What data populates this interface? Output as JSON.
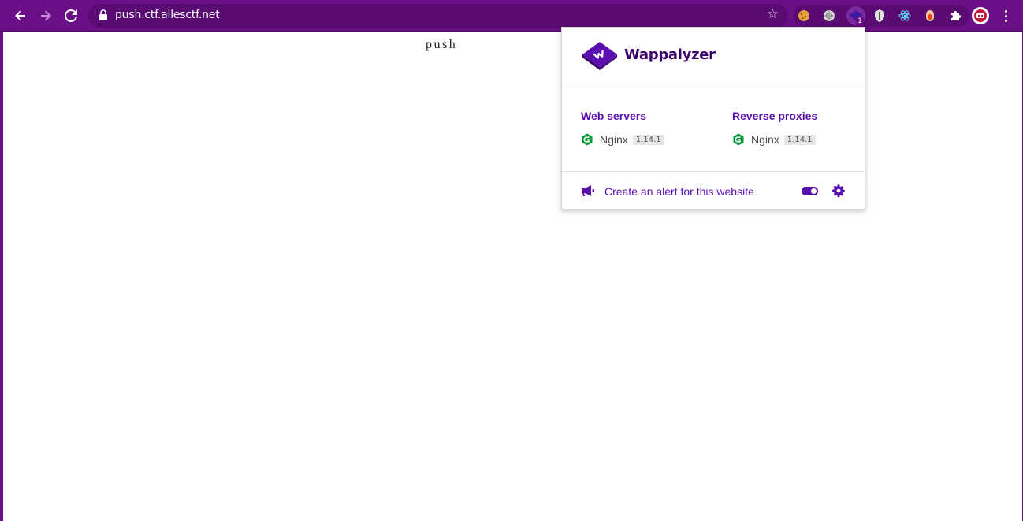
{
  "browser": {
    "back_icon": "arrow-left-icon",
    "forward_icon": "arrow-right-icon",
    "reload_icon": "reload-icon",
    "url": "push.ctf.allesctf.net",
    "badge_count": "1",
    "extensions": [
      "cookie-extension-icon",
      "tracker-extension-icon",
      "wappalyzer-extension-icon",
      "privacy-badger-extension-icon",
      "react-devtools-icon",
      "edit-this-cookie-icon",
      "puzzle-extensions-icon"
    ],
    "colors": {
      "toolbar": "#6a0f86",
      "omnibox": "#5a0a73"
    }
  },
  "page": {
    "text": "push"
  },
  "popup": {
    "brand": "Wappalyzer",
    "categories": [
      {
        "title": "Web servers",
        "tech": {
          "name": "Nginx",
          "version": "1.14.1"
        }
      },
      {
        "title": "Reverse proxies",
        "tech": {
          "name": "Nginx",
          "version": "1.14.1"
        }
      }
    ],
    "footer": {
      "alert_label": "Create an alert for this website"
    },
    "colors": {
      "accent": "#5c0fb0",
      "nginx": "#009639"
    }
  }
}
